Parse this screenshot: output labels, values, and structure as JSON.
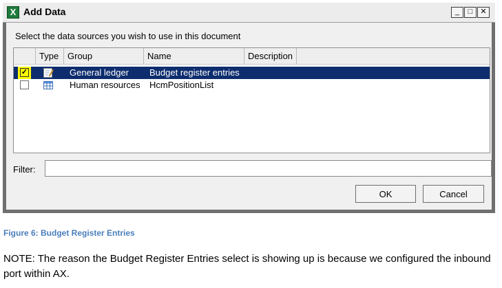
{
  "dialog": {
    "title": "Add Data",
    "app_icon": "excel-icon",
    "app_icon_glyph": "X",
    "window_buttons": {
      "minimize": "_",
      "maximize": "□",
      "close": "✕"
    },
    "instruction": "Select the data sources you wish to use in this document",
    "grid": {
      "columns": [
        "Type",
        "Group",
        "Name",
        "Description"
      ],
      "rows": [
        {
          "checked": true,
          "type_icon": "edit-document-icon",
          "group": "General ledger",
          "name": "Budget register entries",
          "description": ""
        },
        {
          "checked": false,
          "type_icon": "table-icon",
          "group": "Human resources",
          "name": "HcmPositionList",
          "description": ""
        }
      ]
    },
    "filter": {
      "label": "Filter:",
      "value": "",
      "placeholder": ""
    },
    "buttons": {
      "ok": "OK",
      "cancel": "Cancel"
    }
  },
  "caption": "Figure 6:  Budget Register Entries",
  "note": "NOTE:  The reason the Budget Register Entries select is showing up is because we configured the inbound port within AX.",
  "colors": {
    "selection": "#0d2d6e",
    "highlight": "#ffff00",
    "caption": "#4a7ebb",
    "frame": "#6f6f6f"
  }
}
